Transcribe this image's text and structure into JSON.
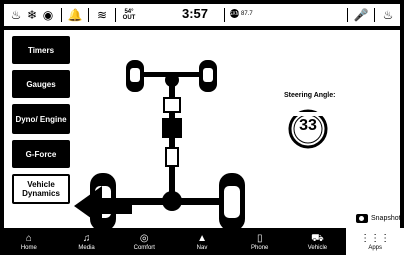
{
  "statusbar": {
    "temperature_line1": "54°",
    "temperature_line2": "OUT",
    "time": "3:57",
    "radio_text": "87.7"
  },
  "menu": {
    "timers": "Timers",
    "gauges": "Gauges",
    "dyno_engine": "Dyno/ Engine",
    "gforce": "G-Force",
    "vehicle_dynamics": "Vehicle Dynamics"
  },
  "steering": {
    "label": "Steering Angle:",
    "value": "33"
  },
  "snapshot": {
    "label": "Snapshot"
  },
  "nav": [
    {
      "label": "Home",
      "icon": "home-icon"
    },
    {
      "label": "Media",
      "icon": "music-icon"
    },
    {
      "label": "Comfort",
      "icon": "comfort-icon"
    },
    {
      "label": "Nav",
      "icon": "nav-icon"
    },
    {
      "label": "Phone",
      "icon": "phone-icon"
    },
    {
      "label": "Vehicle",
      "icon": "car-icon"
    },
    {
      "label": "Apps",
      "icon": "apps-icon"
    }
  ]
}
